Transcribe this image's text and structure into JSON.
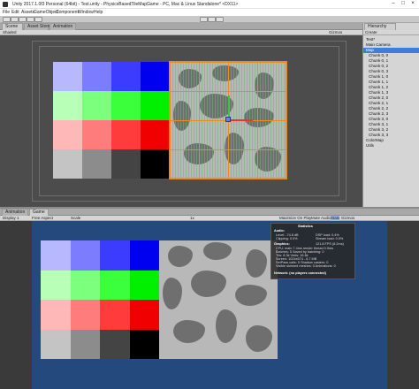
{
  "title_bar": {
    "title": "Unity 2017.1.0f3 Personal (64bit) - Test.unity - PhysicsBasedTileMapGame - PC, Mac & Linux Standalone* <DX11>",
    "min_icon": "minimize-icon",
    "max_icon": "maximize-icon",
    "close_icon": "close-icon",
    "min_glyph": "–",
    "max_glyph": "□",
    "close_glyph": "×"
  },
  "menu": [
    "File",
    "Edit",
    "Assets",
    "GameObject",
    "Component",
    "Window",
    "Help"
  ],
  "scene_panel": {
    "tabs": [
      "Scene",
      "Asset Store",
      "Animation"
    ],
    "shading_mode": "Shaded",
    "gizmos_label": "Gizmos"
  },
  "hierarchy": {
    "tab": "Hierarchy",
    "create_label": "Create",
    "items": [
      {
        "label": "Test*",
        "selected": false
      },
      {
        "label": "Main Camera",
        "selected": false
      },
      {
        "label": "Map",
        "selected": true
      },
      {
        "label": "Chunk 0, 0",
        "selected": false
      },
      {
        "label": "Chunk 0, 1",
        "selected": false
      },
      {
        "label": "Chunk 0, 2",
        "selected": false
      },
      {
        "label": "Chunk 0, 3",
        "selected": false
      },
      {
        "label": "Chunk 1, 0",
        "selected": false
      },
      {
        "label": "Chunk 1, 1",
        "selected": false
      },
      {
        "label": "Chunk 1, 2",
        "selected": false
      },
      {
        "label": "Chunk 1, 3",
        "selected": false
      },
      {
        "label": "Chunk 2, 0",
        "selected": false
      },
      {
        "label": "Chunk 2, 1",
        "selected": false
      },
      {
        "label": "Chunk 2, 2",
        "selected": false
      },
      {
        "label": "Chunk 2, 3",
        "selected": false
      },
      {
        "label": "Chunk 3, 0",
        "selected": false
      },
      {
        "label": "Chunk 3, 1",
        "selected": false
      },
      {
        "label": "Chunk 3, 2",
        "selected": false
      },
      {
        "label": "Chunk 3, 3",
        "selected": false
      },
      {
        "label": "ColorMap",
        "selected": false
      },
      {
        "label": "Utils",
        "selected": false
      }
    ]
  },
  "game_panel": {
    "tabs": [
      "Animation",
      "Game"
    ],
    "display_label": "Display 1",
    "aspect_label": "Free Aspect",
    "scale_label": "Scale",
    "scale_value": "1x",
    "toggles": [
      "Maximize On Play",
      "Mute Audio",
      "Stats",
      "Gizmos"
    ],
    "stats_selected": "Stats"
  },
  "stats": {
    "title": "Statistics",
    "audio_header": "Audio:",
    "audio_lines": [
      "Level: -74.8 dB",
      "DSP load: 0.4%",
      "Clipping: 0.0%",
      "Stream load: 0.0%"
    ],
    "graphics_header": "Graphics:",
    "fps": "121.8 FPS (8.2ms)",
    "graphics_lines": [
      "CPU: main 7.4ms  render thread 0.9ms",
      "Batches: 5  Saved by batching: 0",
      "Tris: 8.3k  Verts: 16.6k",
      "Screen: 1024x574 - 6.7 MB",
      "SetPass calls: 5  Shadow casters: 0",
      "Visible skinned meshes: 0  Animations: 0"
    ],
    "network": "Network: (no players connected)"
  },
  "palette": {
    "rows": [
      [
        "#b8b8ff",
        "#7c7cff",
        "#3c3cff",
        "#0000f0"
      ],
      [
        "#b8ffb8",
        "#7cff7c",
        "#3cff3c",
        "#00f000"
      ],
      [
        "#ffb8b8",
        "#ff7c7c",
        "#ff3c3c",
        "#f00000"
      ],
      [
        "#c4c4c4",
        "#8c8c8c",
        "#444444",
        "#000000"
      ]
    ]
  },
  "accent": {
    "selection": "#f08a1a",
    "hierarchy_selection": "#3f7ed8",
    "game_background": "#24497c"
  }
}
